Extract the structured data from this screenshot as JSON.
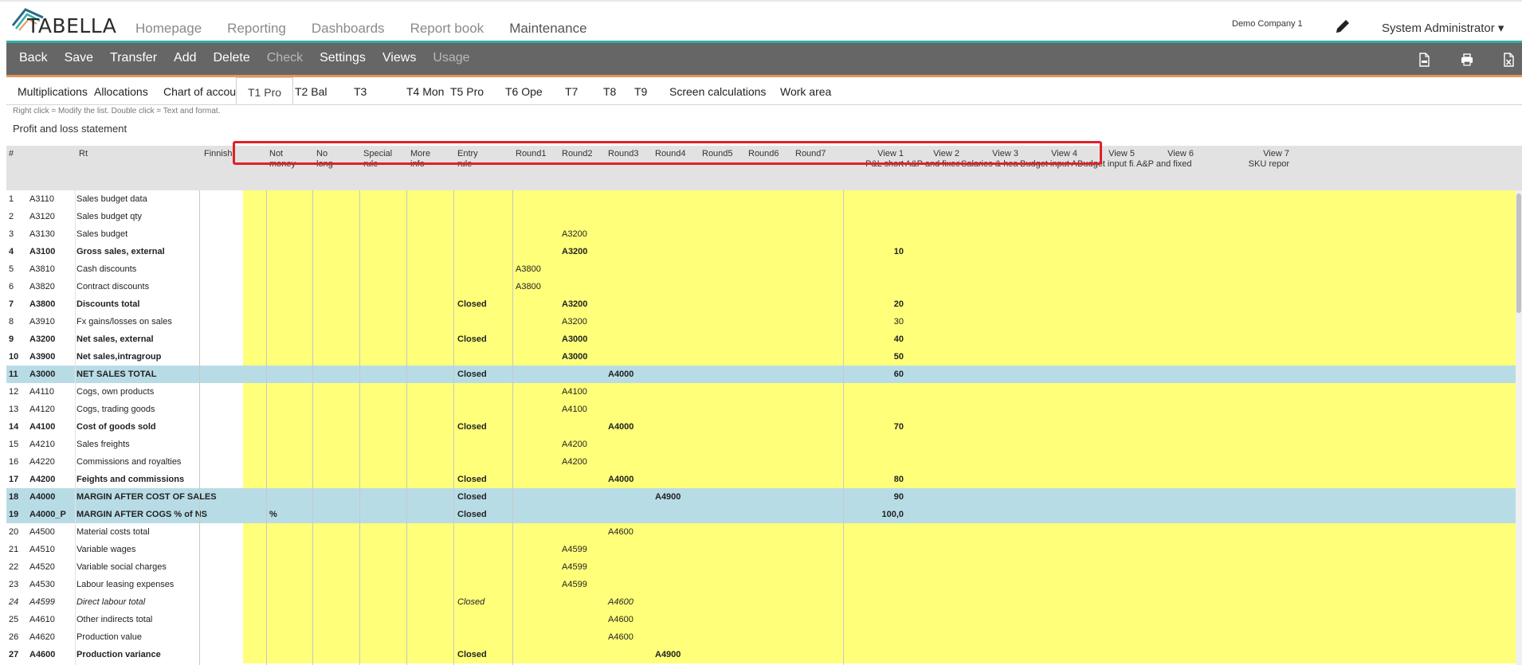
{
  "app": {
    "logo_text": "TABELLA"
  },
  "nav": {
    "items": [
      "Homepage",
      "Reporting",
      "Dashboards",
      "Report book",
      "Maintenance"
    ],
    "active_index": 4
  },
  "header": {
    "company": "Demo Company 1",
    "user": "System Administrator ▾"
  },
  "toolbar": {
    "buttons": [
      {
        "label": "Back",
        "enabled": true
      },
      {
        "label": "Save",
        "enabled": true
      },
      {
        "label": "Transfer",
        "enabled": true
      },
      {
        "label": "Add",
        "enabled": true
      },
      {
        "label": "Delete",
        "enabled": true
      },
      {
        "label": "Check",
        "enabled": false
      },
      {
        "label": "Settings",
        "enabled": true
      },
      {
        "label": "Views",
        "enabled": true
      },
      {
        "label": "Usage",
        "enabled": false
      }
    ],
    "icons": [
      "pdf-export-icon",
      "print-icon",
      "excel-export-icon"
    ]
  },
  "tabs": {
    "items": [
      "Multiplications",
      "Allocations",
      "Chart of accounts",
      "T1 Pro",
      "T2 Bal",
      "T3",
      "T4 Mon",
      "T5 Pro",
      "T6 Ope",
      "T7",
      "T8",
      "T9",
      "Screen calculations",
      "Work area"
    ],
    "active_index": 3
  },
  "hint": "Right click = Modify the list. Double click = Text and format.",
  "section_title": "Profit and loss statement",
  "grid": {
    "headers": [
      {
        "key": "num",
        "line1": "#",
        "line2": ""
      },
      {
        "key": "rt",
        "line1": "Rt",
        "line2": ""
      },
      {
        "key": "finnish",
        "line1": "Finnish",
        "line2": ""
      },
      {
        "key": "notmoney",
        "line1": "Not",
        "line2": "money"
      },
      {
        "key": "nolong",
        "line1": "No",
        "line2": "long"
      },
      {
        "key": "special",
        "line1": "Special",
        "line2": "rule"
      },
      {
        "key": "more",
        "line1": "More",
        "line2": "info"
      },
      {
        "key": "entry",
        "line1": "Entry",
        "line2": "rule"
      },
      {
        "key": "r1",
        "line1": "Round1",
        "line2": ""
      },
      {
        "key": "r2",
        "line1": "Round2",
        "line2": ""
      },
      {
        "key": "r3",
        "line1": "Round3",
        "line2": ""
      },
      {
        "key": "r4",
        "line1": "Round4",
        "line2": ""
      },
      {
        "key": "r5",
        "line1": "Round5",
        "line2": ""
      },
      {
        "key": "r6",
        "line1": "Round6",
        "line2": ""
      },
      {
        "key": "r7",
        "line1": "Round7",
        "line2": ""
      },
      {
        "key": "v1",
        "line1": "View 1",
        "line2": "P&L short"
      },
      {
        "key": "v2",
        "line1": "View 2",
        "line2": "A&P and fixed ..."
      },
      {
        "key": "v3",
        "line1": "View 3",
        "line2": "Salaries & hea..."
      },
      {
        "key": "v4",
        "line1": "View 4",
        "line2": "Budget input A..."
      },
      {
        "key": "v5",
        "line1": "View 5",
        "line2": "Budget input fi..."
      },
      {
        "key": "v6",
        "line1": "View 6",
        "line2": "A&P and fixed ..."
      },
      {
        "key": "v7",
        "line1": "View 7",
        "line2": "SKU repor"
      }
    ],
    "rows": [
      {
        "num": "1",
        "code": "A3110",
        "name": "Sales budget data",
        "style": "normal"
      },
      {
        "num": "2",
        "code": "A3120",
        "name": "Sales budget qty",
        "style": "normal"
      },
      {
        "num": "3",
        "code": "A3130",
        "name": "Sales budget",
        "style": "normal",
        "r2": "A3200"
      },
      {
        "num": "4",
        "code": "A3100",
        "name": "Gross sales, external",
        "style": "bold",
        "r2": "A3200",
        "v1": "10"
      },
      {
        "num": "5",
        "code": "A3810",
        "name": "Cash discounts",
        "style": "normal",
        "r1": "A3800"
      },
      {
        "num": "6",
        "code": "A3820",
        "name": "Contract discounts",
        "style": "normal",
        "r1": "A3800"
      },
      {
        "num": "7",
        "code": "A3800",
        "name": "Discounts total",
        "style": "bold",
        "entry": "Closed",
        "r2": "A3200",
        "v1": "20"
      },
      {
        "num": "8",
        "code": "A3910",
        "name": "Fx gains/losses on sales",
        "style": "normal",
        "r2": "A3200",
        "v1": "30"
      },
      {
        "num": "9",
        "code": "A3200",
        "name": "Net sales, external",
        "style": "bold",
        "entry": "Closed",
        "r2": "A3000",
        "v1": "40"
      },
      {
        "num": "10",
        "code": "A3900",
        "name": "Net sales,intragroup",
        "style": "bold",
        "r2": "A3000",
        "v1": "50"
      },
      {
        "num": "11",
        "code": "A3000",
        "name": "NET SALES TOTAL",
        "style": "bold",
        "hl": true,
        "entry": "Closed",
        "r3": "A4000",
        "v1": "60"
      },
      {
        "num": "12",
        "code": "A4110",
        "name": "Cogs, own products",
        "style": "normal",
        "r2": "A4100"
      },
      {
        "num": "13",
        "code": "A4120",
        "name": "Cogs, trading goods",
        "style": "normal",
        "r2": "A4100"
      },
      {
        "num": "14",
        "code": "A4100",
        "name": "Cost of goods sold",
        "style": "bold",
        "entry": "Closed",
        "r3": "A4000",
        "v1": "70"
      },
      {
        "num": "15",
        "code": "A4210",
        "name": "Sales freights",
        "style": "normal",
        "r2": "A4200"
      },
      {
        "num": "16",
        "code": "A4220",
        "name": "Commissions and royalties",
        "style": "normal",
        "r2": "A4200"
      },
      {
        "num": "17",
        "code": "A4200",
        "name": "Feights and commissions",
        "style": "bold",
        "entry": "Closed",
        "r3": "A4000",
        "v1": "80"
      },
      {
        "num": "18",
        "code": "A4000",
        "name": "MARGIN AFTER COST OF SALES",
        "style": "bold",
        "hl": true,
        "entry": "Closed",
        "r4": "A4900",
        "v1": "90"
      },
      {
        "num": "19",
        "code": "A4000_P",
        "name": "MARGIN AFTER COGS % of NS",
        "style": "bold",
        "hl": true,
        "notmoney": "%",
        "entry": "Closed",
        "v1": "100,0"
      },
      {
        "num": "20",
        "code": "A4500",
        "name": "Material costs total",
        "style": "normal",
        "r3": "A4600"
      },
      {
        "num": "21",
        "code": "A4510",
        "name": "Variable wages",
        "style": "normal",
        "r2": "A4599"
      },
      {
        "num": "22",
        "code": "A4520",
        "name": "Variable social charges",
        "style": "normal",
        "r2": "A4599"
      },
      {
        "num": "23",
        "code": "A4530",
        "name": "Labour leasing expenses",
        "style": "normal",
        "r2": "A4599"
      },
      {
        "num": "24",
        "code": "A4599",
        "name": "Direct labour total",
        "style": "italic",
        "entry": "Closed",
        "r3": "A4600"
      },
      {
        "num": "25",
        "code": "A4610",
        "name": "Other indirects total",
        "style": "normal",
        "r3": "A4600"
      },
      {
        "num": "26",
        "code": "A4620",
        "name": "Production value",
        "style": "normal",
        "r3": "A4600"
      },
      {
        "num": "27",
        "code": "A4600",
        "name": "Production variance",
        "style": "bold",
        "entry": "Closed",
        "r4": "A4900"
      }
    ]
  }
}
